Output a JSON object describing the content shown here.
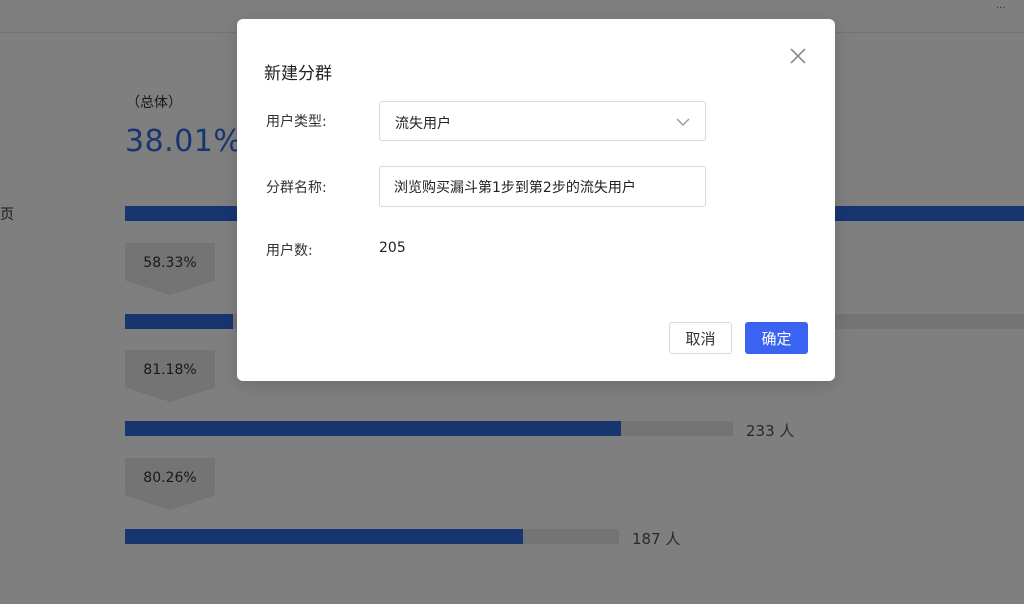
{
  "background": {
    "corner_text": "...",
    "left_edge_text": "页",
    "overall_label": "（总体）",
    "overall_value": "38.01%",
    "funnel_steps": [
      {
        "fill": 1.0,
        "count": ""
      },
      {
        "fill": 1.0,
        "count": ""
      },
      {
        "fill": 0.81,
        "count": "233 人"
      },
      {
        "fill": 0.81,
        "count": "187 人"
      }
    ],
    "conversions": [
      "58.33%",
      "81.18%",
      "80.26%"
    ]
  },
  "modal": {
    "title": "新建分群",
    "user_type_label": "用户类型:",
    "user_type_value": "流失用户",
    "group_name_label": "分群名称:",
    "group_name_value": "浏览购买漏斗第1步到第2步的流失用户",
    "user_count_label": "用户数:",
    "user_count_value": "205",
    "cancel_label": "取消",
    "ok_label": "确定"
  },
  "colors": {
    "accent": "#3b63f2",
    "bar": "#2f6de0",
    "overlay": "rgba(0,0,0,0.5)"
  },
  "icons": [
    "close-icon",
    "chevron-down-icon"
  ]
}
